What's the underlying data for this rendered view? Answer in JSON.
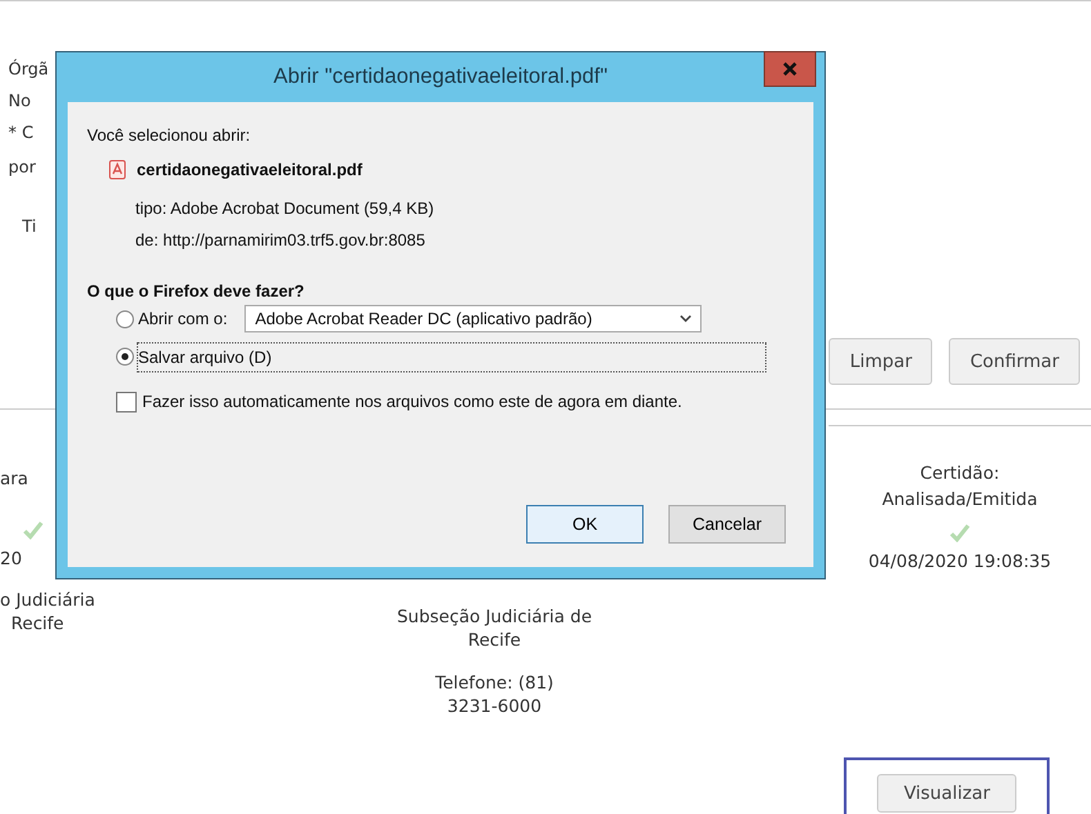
{
  "page": {
    "form_labels": [
      "Órgã",
      "No",
      "* C",
      "por",
      "Ti"
    ],
    "form_buttons": [
      {
        "label": "Limpar"
      },
      {
        "label": "Confirmar"
      }
    ],
    "results": {
      "left": {
        "header": "ara",
        "date": "20",
        "office": [
          "o Judiciária",
          "Recife"
        ]
      },
      "middle": {
        "office": "Subseção Judiciária de Recife",
        "phone": "Telefone: (81) 3231-6000"
      },
      "right": {
        "header": "Certidão: Analisada/Emitida",
        "date": "04/08/2020 19:08:35"
      }
    },
    "view_button": {
      "label": "Visualizar",
      "highlighted": true
    }
  },
  "dialog": {
    "title": "Abrir \"certidaonegativaeleitoral.pdf\"",
    "intro": "Você selecionou abrir:",
    "file_name": "certidaonegativaeleitoral.pdf",
    "file_type": "tipo:  Adobe Acrobat Document (59,4 KB)",
    "file_source": "de:  http://parnamirim03.trf5.gov.br:8085",
    "question": "O que o Firefox deve fazer?",
    "options": [
      {
        "kind": "open",
        "label": "Abrir com o:",
        "selected": false,
        "app": "Adobe Acrobat Reader DC  (aplicativo padrão)"
      },
      {
        "kind": "save",
        "label": "Salvar arquivo (D)",
        "selected": true
      }
    ],
    "auto": {
      "label": "Fazer isso automaticamente nos arquivos como este de agora em diante.",
      "checked": false
    },
    "buttons": [
      {
        "label": "OK",
        "default": true
      },
      {
        "label": "Cancelar",
        "default": false
      }
    ]
  }
}
